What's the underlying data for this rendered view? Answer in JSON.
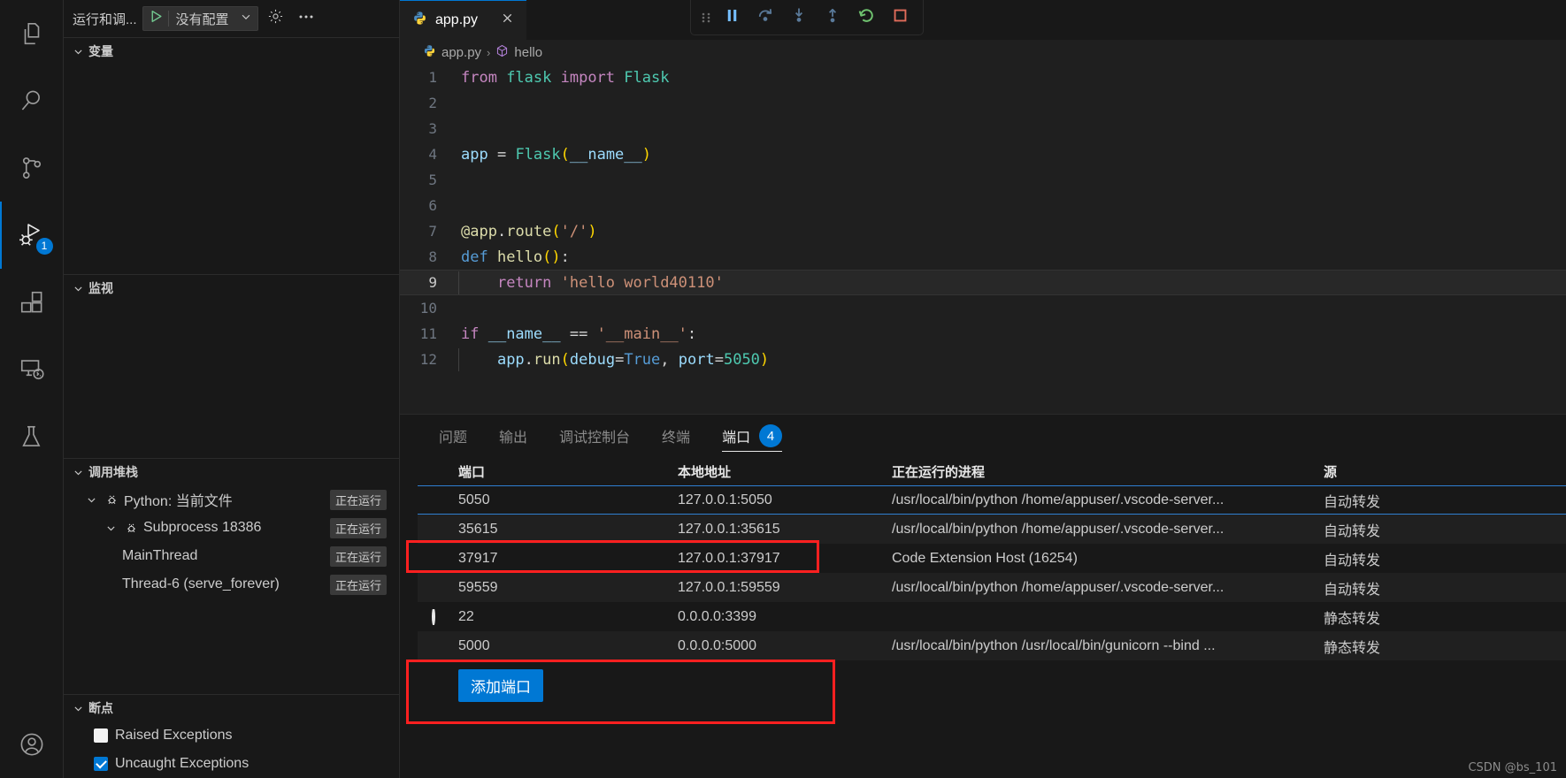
{
  "activitybar": {
    "items": [
      {
        "name": "explorer",
        "icon": "files-icon",
        "badge": null
      },
      {
        "name": "search",
        "icon": "search-icon",
        "badge": null
      },
      {
        "name": "source-control",
        "icon": "source-control-icon",
        "badge": null
      },
      {
        "name": "run-and-debug",
        "icon": "run-debug-icon",
        "badge": "1"
      },
      {
        "name": "extensions",
        "icon": "extensions-icon",
        "badge": null
      },
      {
        "name": "remote-explorer",
        "icon": "remote-explorer-icon",
        "badge": null
      },
      {
        "name": "testing",
        "icon": "testing-flask-icon",
        "badge": null
      }
    ],
    "account_icon": "account-icon",
    "active_index": 3
  },
  "sidebar": {
    "title": "运行和调...",
    "launch": {
      "play_icon": "play-icon",
      "config_label": "没有配置",
      "chevron_icon": "chevron-down-icon"
    },
    "gear_icon": "gear-icon",
    "more_icon": "more-actions-icon",
    "sections": {
      "variables": {
        "label": "变量"
      },
      "watch": {
        "label": "监视"
      },
      "callstack": {
        "label": "调用堆栈",
        "rows": [
          {
            "label": "Python: 当前文件",
            "status": "正在运行",
            "indent": 1,
            "twisty": true,
            "bug": true
          },
          {
            "label": "Subprocess 18386",
            "status": "正在运行",
            "indent": 2,
            "twisty": true,
            "bug": true
          },
          {
            "label": "MainThread",
            "status": "正在运行",
            "indent": 3,
            "twisty": false,
            "bug": false
          },
          {
            "label": "Thread-6 (serve_forever)",
            "status": "正在运行",
            "indent": 3,
            "twisty": false,
            "bug": false
          }
        ]
      },
      "breakpoints": {
        "label": "断点",
        "items": [
          {
            "label": "Raised Exceptions",
            "checked": false
          },
          {
            "label": "Uncaught Exceptions",
            "checked": true
          }
        ]
      }
    }
  },
  "editor": {
    "tab": {
      "label": "app.py",
      "icon": "python-file-icon",
      "close_icon": "close-icon"
    },
    "breadcrumb": {
      "file": "app.py",
      "symbol": "hello",
      "file_icon": "python-file-icon",
      "symbol_icon": "symbol-method-icon",
      "separator": "›"
    },
    "debug_toolbar": [
      {
        "name": "drag-handle",
        "icon": "grip-icon"
      },
      {
        "name": "pause-button",
        "icon": "pause-icon"
      },
      {
        "name": "step-over-button",
        "icon": "step-over-icon"
      },
      {
        "name": "step-into-button",
        "icon": "step-into-icon"
      },
      {
        "name": "step-out-button",
        "icon": "step-out-icon"
      },
      {
        "name": "restart-button",
        "icon": "restart-icon"
      },
      {
        "name": "stop-button",
        "icon": "stop-icon"
      }
    ],
    "current_line": 9,
    "lines": [
      {
        "n": "1",
        "tokens": [
          {
            "t": "from ",
            "c": "t-kw"
          },
          {
            "t": "flask ",
            "c": "t-mod"
          },
          {
            "t": "import ",
            "c": "t-kw"
          },
          {
            "t": "Flask",
            "c": "t-cls"
          }
        ]
      },
      {
        "n": "2",
        "tokens": []
      },
      {
        "n": "3",
        "tokens": []
      },
      {
        "n": "4",
        "tokens": [
          {
            "t": "app ",
            "c": "t-var"
          },
          {
            "t": "= ",
            "c": "t-op"
          },
          {
            "t": "Flask",
            "c": "t-cls"
          },
          {
            "t": "(",
            "c": "t-par"
          },
          {
            "t": "__name__",
            "c": "t-var"
          },
          {
            "t": ")",
            "c": "t-par"
          }
        ]
      },
      {
        "n": "5",
        "tokens": []
      },
      {
        "n": "6",
        "tokens": []
      },
      {
        "n": "7",
        "tokens": [
          {
            "t": "@app",
            "c": "t-fn"
          },
          {
            "t": ".",
            "c": "t-plain"
          },
          {
            "t": "route",
            "c": "t-fn"
          },
          {
            "t": "(",
            "c": "t-par"
          },
          {
            "t": "'/'",
            "c": "t-str"
          },
          {
            "t": ")",
            "c": "t-par"
          }
        ]
      },
      {
        "n": "8",
        "tokens": [
          {
            "t": "def ",
            "c": "t-kw2"
          },
          {
            "t": "hello",
            "c": "t-fn"
          },
          {
            "t": "()",
            "c": "t-par"
          },
          {
            "t": ":",
            "c": "t-plain"
          }
        ]
      },
      {
        "n": "9",
        "tokens": [
          {
            "t": "    ",
            "c": "t-plain"
          },
          {
            "t": "return ",
            "c": "t-kw"
          },
          {
            "t": "'hello world40110'",
            "c": "t-str"
          }
        ]
      },
      {
        "n": "10",
        "tokens": []
      },
      {
        "n": "11",
        "tokens": [
          {
            "t": "if ",
            "c": "t-kw"
          },
          {
            "t": "__name__ ",
            "c": "t-var"
          },
          {
            "t": "== ",
            "c": "t-op"
          },
          {
            "t": "'__main__'",
            "c": "t-str"
          },
          {
            "t": ":",
            "c": "t-plain"
          }
        ]
      },
      {
        "n": "12",
        "tokens": [
          {
            "t": "    ",
            "c": "t-plain"
          },
          {
            "t": "app",
            "c": "t-var"
          },
          {
            "t": ".",
            "c": "t-plain"
          },
          {
            "t": "run",
            "c": "t-fn"
          },
          {
            "t": "(",
            "c": "t-par"
          },
          {
            "t": "debug",
            "c": "t-var"
          },
          {
            "t": "=",
            "c": "t-op"
          },
          {
            "t": "True",
            "c": "t-kw2"
          },
          {
            "t": ", ",
            "c": "t-plain"
          },
          {
            "t": "port",
            "c": "t-var"
          },
          {
            "t": "=",
            "c": "t-op"
          },
          {
            "t": "5050",
            "c": "t-mod"
          },
          {
            "t": ")",
            "c": "t-par"
          }
        ]
      }
    ]
  },
  "panel": {
    "tabs": [
      {
        "label": "问题",
        "active": false,
        "badge": null
      },
      {
        "label": "输出",
        "active": false,
        "badge": null
      },
      {
        "label": "调试控制台",
        "active": false,
        "badge": null
      },
      {
        "label": "终端",
        "active": false,
        "badge": null
      },
      {
        "label": "端口",
        "active": true,
        "badge": "4"
      }
    ],
    "ports_table": {
      "headers": {
        "port": "端口",
        "address": "本地地址",
        "process": "正在运行的进程",
        "source": "源"
      },
      "rows": [
        {
          "status": "running",
          "port": "5050",
          "address": "127.0.0.1:5050",
          "process": "/usr/local/bin/python /home/appuser/.vscode-server...",
          "source": "自动转发",
          "selected": true
        },
        {
          "status": "running",
          "port": "35615",
          "address": "127.0.0.1:35615",
          "process": "/usr/local/bin/python /home/appuser/.vscode-server...",
          "source": "自动转发",
          "selected": false
        },
        {
          "status": "running",
          "port": "37917",
          "address": "127.0.0.1:37917",
          "process": "Code Extension Host (16254)",
          "source": "自动转发",
          "selected": false
        },
        {
          "status": "running",
          "port": "59559",
          "address": "127.0.0.1:59559",
          "process": "/usr/local/bin/python /home/appuser/.vscode-server...",
          "source": "自动转发",
          "selected": false
        },
        {
          "status": "stopped",
          "port": "22",
          "address": "0.0.0.0:3399",
          "process": "",
          "source": "静态转发",
          "selected": false
        },
        {
          "status": "running",
          "port": "5000",
          "address": "0.0.0.0:5000",
          "process": "/usr/local/bin/python /usr/local/bin/gunicorn --bind ...",
          "source": "静态转发",
          "selected": false
        }
      ]
    },
    "add_port_button": "添加端口"
  },
  "watermark": "CSDN @bs_101",
  "colors": {
    "accent": "#0078d4",
    "highlight_box": "#ff2020",
    "status_running": "#3fb950",
    "restart": "#6fc26f",
    "stop": "#e06c5a"
  }
}
